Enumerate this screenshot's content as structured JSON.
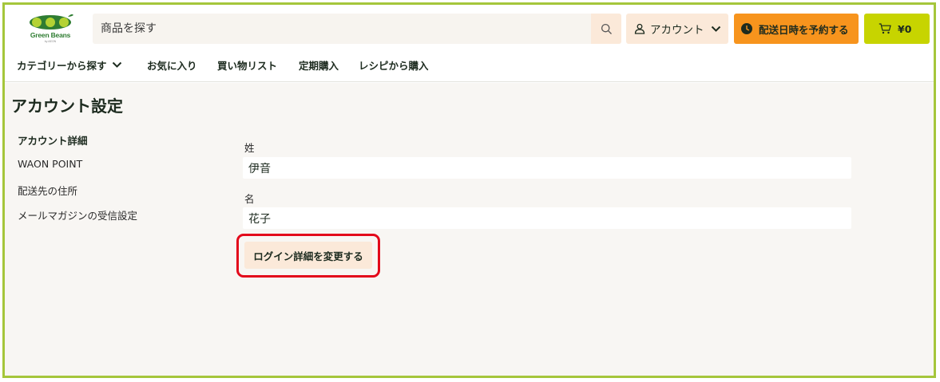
{
  "brand": {
    "logo_text": "Green Beans",
    "logo_sub": "by AEON",
    "colors": {
      "frame": "#a5c63b",
      "logo_green": "#2f7d32",
      "reserve": "#f7941d",
      "cart": "#c7d400",
      "peach": "#fbe9d9",
      "highlight": "#e3091b"
    }
  },
  "header": {
    "search": {
      "placeholder": "商品を探す",
      "icon": "search-icon"
    },
    "account": {
      "label": "アカウント",
      "icon": "user-icon"
    },
    "reserve": {
      "label": "配送日時を予約する",
      "icon": "clock-icon"
    },
    "cart": {
      "label": "¥0",
      "icon": "cart-icon"
    }
  },
  "nav": {
    "items": [
      {
        "label": "カテゴリーから探す"
      },
      {
        "label": "お気に入り"
      },
      {
        "label": "買い物リスト"
      },
      {
        "label": "定期購入"
      },
      {
        "label": "レシピから購入"
      }
    ]
  },
  "page": {
    "title": "アカウント設定",
    "sidebar": {
      "items": [
        {
          "label": "アカウント詳細"
        },
        {
          "label": "WAON POINT"
        },
        {
          "label": "配送先の住所"
        },
        {
          "label": "メールマガジンの受信設定"
        }
      ]
    },
    "form": {
      "last_name_label": "姓",
      "last_name_value": "伊音",
      "first_name_label": "名",
      "first_name_value": "花子",
      "change_button": "ログイン詳細を変更する"
    }
  }
}
